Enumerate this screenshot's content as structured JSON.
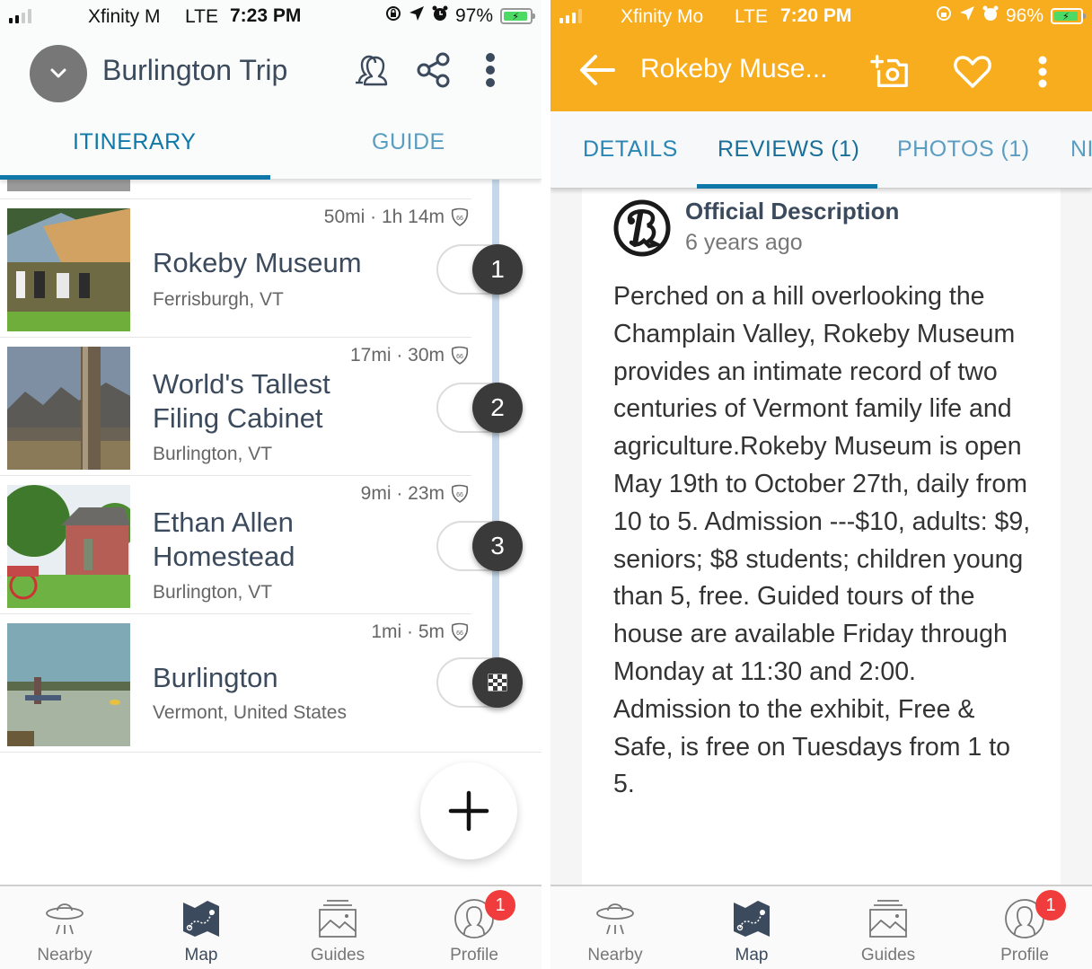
{
  "left_screen": {
    "status_bar": {
      "carrier": "Xfinity M",
      "network": "LTE",
      "time": "7:23 PM",
      "battery": "97%",
      "icons": [
        "rotation-lock-icon",
        "location-arrow-icon",
        "alarm-icon",
        "battery-charging-icon"
      ]
    },
    "header": {
      "title": "Burlington Trip",
      "icons": [
        "chevron-down-icon",
        "collaborators-icon",
        "share-icon",
        "more-vertical-icon"
      ]
    },
    "tabs": [
      {
        "label": "ITINERARY",
        "active": true
      },
      {
        "label": "GUIDE",
        "active": false
      }
    ],
    "itinerary": [
      {
        "order": "1",
        "name": "Rokeby Museum",
        "location": "Ferrisburgh, VT",
        "distance": "50mi · 1h 14m",
        "route_icon": "highway-shield-icon"
      },
      {
        "order": "2",
        "name": "World's Tallest Filing Cabinet",
        "location": "Burlington, VT",
        "distance": "17mi · 30m",
        "route_icon": "highway-shield-icon"
      },
      {
        "order": "3",
        "name": "Ethan Allen Homestead",
        "location": "Burlington, VT",
        "distance": "9mi · 23m",
        "route_icon": "highway-shield-icon"
      },
      {
        "order": "finish",
        "name": "Burlington",
        "location": "Vermont, United States",
        "distance": "1mi · 5m",
        "route_icon": "highway-shield-icon"
      }
    ],
    "fab_icon": "plus-icon"
  },
  "right_screen": {
    "status_bar": {
      "carrier": "Xfinity Mo",
      "network": "LTE",
      "time": "7:20 PM",
      "battery": "96%"
    },
    "header": {
      "title": "Rokeby Muse...",
      "icons": [
        "back-arrow-icon",
        "add-photo-icon",
        "heart-icon",
        "more-vertical-icon"
      ],
      "color": "#f7ad1e"
    },
    "tabs": [
      {
        "label": "DETAILS",
        "active": false
      },
      {
        "label": "REVIEWS (1)",
        "active": true
      },
      {
        "label": "PHOTOS (1)",
        "active": false
      },
      {
        "label": "NI",
        "active": false
      }
    ],
    "review": {
      "author": "Official Description",
      "time": "6 years ago",
      "text": "Perched on a hill overlooking the Champlain Valley, Rokeby Museum provides an intimate record of two centuries of Vermont family life and agriculture.Rokeby Museum is open May 19th to October 27th, daily from 10 to 5. Admission ---$10, adults: $9, seniors; $8 students; children young than 5, free. Guided tours of the house are available Friday through Monday at 11:30 and 2:00. Admission to the exhibit, Free & Safe, is free on Tuesdays from 1 to 5."
    }
  },
  "bottom_nav": {
    "items": [
      {
        "label": "Nearby",
        "icon": "ufo-icon",
        "active": false
      },
      {
        "label": "Map",
        "icon": "map-icon",
        "active": true
      },
      {
        "label": "Guides",
        "icon": "guides-icon",
        "active": false
      },
      {
        "label": "Profile",
        "icon": "profile-icon",
        "active": false,
        "badge": "1"
      }
    ]
  },
  "colors": {
    "accent": "#1078a8",
    "header_text": "#3b4a5c",
    "place_header": "#f7ad1e",
    "notification": "#f03c3c",
    "timeline": "#c5d8ea"
  }
}
